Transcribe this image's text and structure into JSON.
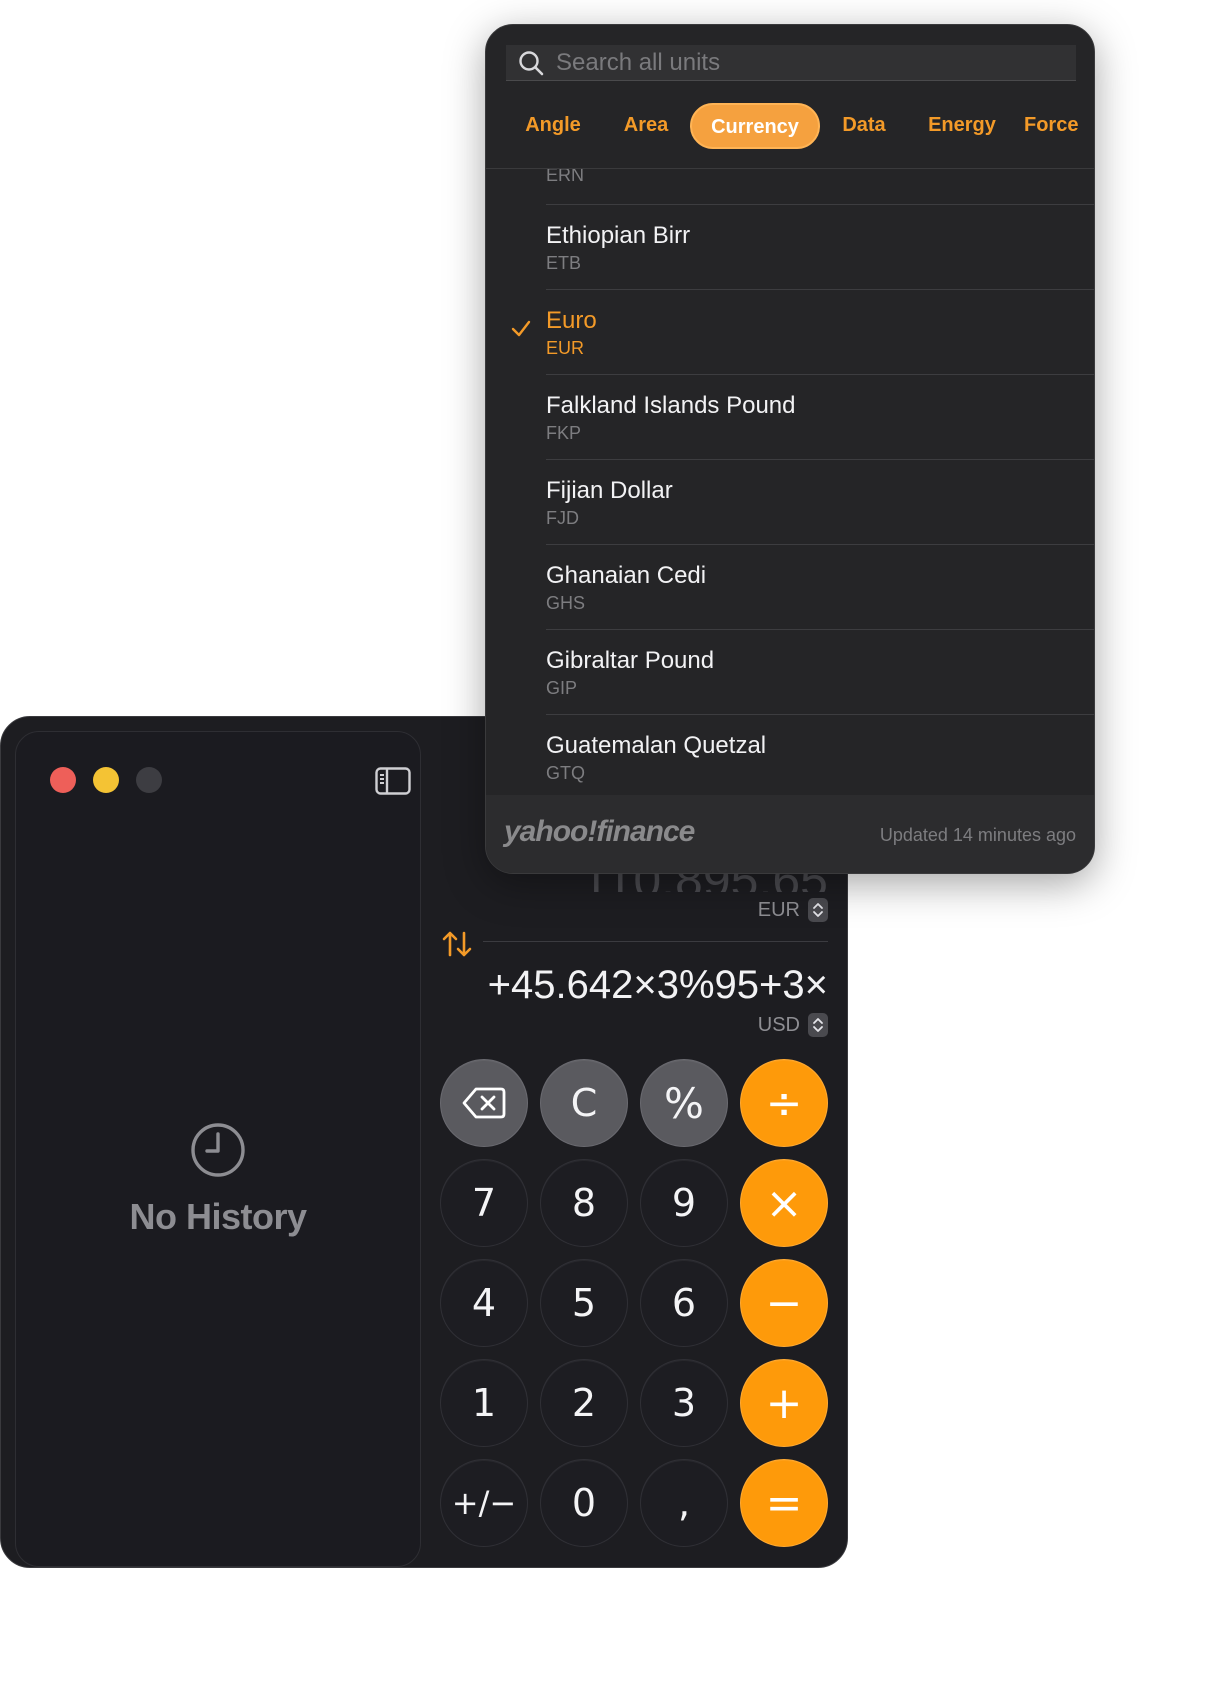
{
  "calculator": {
    "window_controls": [
      "close",
      "minimize",
      "maximize"
    ],
    "sidebar": {
      "toggle_icon": "sidebar-icon",
      "empty_icon": "clock-icon",
      "empty_text": "No History"
    },
    "display": {
      "converted_value": "110.895,65",
      "converted_unit": "EUR",
      "swap_icon": "arrow-up-down-icon",
      "expression": "+45.642×3%95+3×",
      "input_unit": "USD"
    },
    "keypad": [
      [
        "⌫",
        "C",
        "%",
        "÷"
      ],
      [
        "7",
        "8",
        "9",
        "×"
      ],
      [
        "4",
        "5",
        "6",
        "−"
      ],
      [
        "1",
        "2",
        "3",
        "+"
      ],
      [
        "+/−",
        "0",
        ",",
        "="
      ]
    ]
  },
  "unit_picker": {
    "search_placeholder": "Search all units",
    "tabs": [
      "Angle",
      "Area",
      "Currency",
      "Data",
      "Energy",
      "Force"
    ],
    "active_tab": "Currency",
    "items": [
      {
        "name": "",
        "code": "ERN"
      },
      {
        "name": "Ethiopian Birr",
        "code": "ETB"
      },
      {
        "name": "Euro",
        "code": "EUR",
        "selected": true
      },
      {
        "name": "Falkland Islands Pound",
        "code": "FKP"
      },
      {
        "name": "Fijian Dollar",
        "code": "FJD"
      },
      {
        "name": "Ghanaian Cedi",
        "code": "GHS"
      },
      {
        "name": "Gibraltar Pound",
        "code": "GIP"
      },
      {
        "name": "Guatemalan Quetzal",
        "code": "GTQ"
      }
    ],
    "footer": {
      "provider": "yahoo!finance",
      "updated": "Updated 14 minutes ago"
    }
  },
  "colors": {
    "accent": "#f39a28",
    "operator_key": "#fe9a0a",
    "function_key": "#5a5a5f",
    "digit_key": "#1d1d22"
  }
}
